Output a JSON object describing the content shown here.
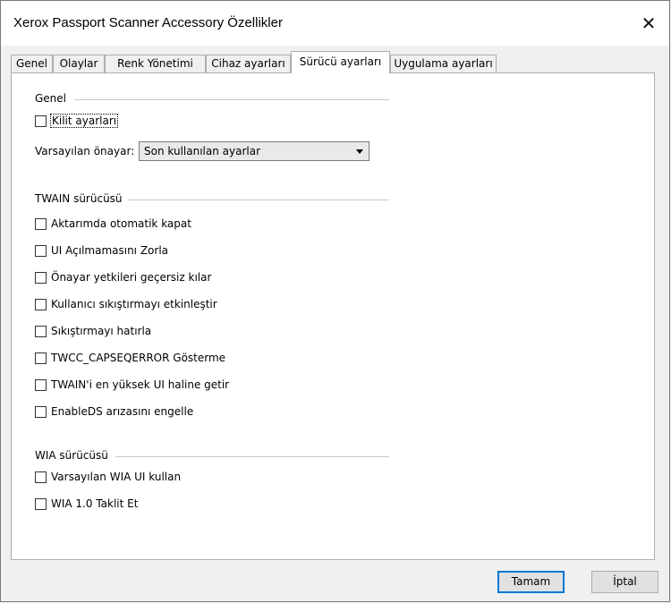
{
  "window": {
    "title": "Xerox Passport Scanner Accessory Özellikler",
    "close_glyph": "✕"
  },
  "tabs": [
    {
      "label": "Genel"
    },
    {
      "label": "Olaylar"
    },
    {
      "label": "Renk Yönetimi"
    },
    {
      "label": "Cihaz ayarları"
    },
    {
      "label": "Sürücü ayarları",
      "active": true
    },
    {
      "label": "Uygulama ayarları"
    }
  ],
  "general": {
    "heading": "Genel",
    "lock_settings": {
      "label": "Kilit ayarları",
      "checked": false
    },
    "default_preset_label": "Varsayılan önayar:",
    "default_preset_value": "Son kullanılan ayarlar"
  },
  "twain": {
    "heading": "TWAIN sürücüsü",
    "options": [
      {
        "label": "Aktarımda otomatik kapat",
        "checked": false
      },
      {
        "label": "UI Açılmamasını Zorla",
        "checked": false
      },
      {
        "label": "Önayar yetkileri geçersiz kılar",
        "checked": false
      },
      {
        "label": "Kullanıcı sıkıştırmayı etkinleştir",
        "checked": false
      },
      {
        "label": "Sıkıştırmayı hatırla",
        "checked": false
      },
      {
        "label": "TWCC_CAPSEQERROR Gösterme",
        "checked": false
      },
      {
        "label": "TWAIN'i en yüksek UI haline getir",
        "checked": false
      },
      {
        "label": "EnableDS arızasını engelle",
        "checked": false
      }
    ]
  },
  "wia": {
    "heading": "WIA sürücüsü",
    "options": [
      {
        "label": "Varsayılan WIA UI kullan",
        "checked": false
      },
      {
        "label": "WIA 1.0 Taklit Et",
        "checked": false
      }
    ]
  },
  "buttons": {
    "ok": "Tamam",
    "cancel": "İptal"
  },
  "colors": {
    "focus_border": "#0078d7"
  }
}
